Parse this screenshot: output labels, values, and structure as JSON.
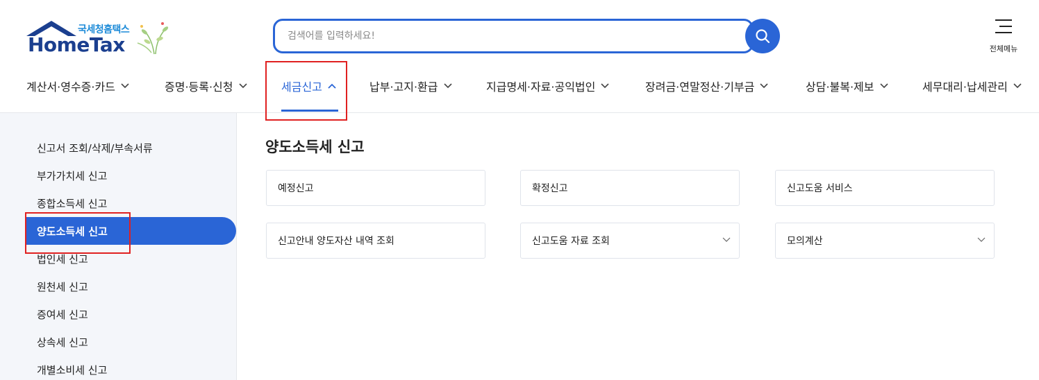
{
  "logo": {
    "sub": "국세청홈택스",
    "main": "HomeTax"
  },
  "search": {
    "placeholder": "검색어를 입력하세요!"
  },
  "menu_all": {
    "label": "전체메뉴"
  },
  "nav": {
    "items": [
      {
        "label": "계산서·영수증·카드"
      },
      {
        "label": "증명·등록·신청"
      },
      {
        "label": "세금신고"
      },
      {
        "label": "납부·고지·환급"
      },
      {
        "label": "지급명세·자료·공익법인"
      },
      {
        "label": "장려금·연말정산·기부금"
      },
      {
        "label": "상담·불복·제보"
      },
      {
        "label": "세무대리·납세관리"
      }
    ]
  },
  "sidebar": {
    "items": [
      {
        "label": "신고서 조회/삭제/부속서류"
      },
      {
        "label": "부가가치세 신고"
      },
      {
        "label": "종합소득세 신고"
      },
      {
        "label": "양도소득세 신고"
      },
      {
        "label": "법인세 신고"
      },
      {
        "label": "원천세 신고"
      },
      {
        "label": "증여세 신고"
      },
      {
        "label": "상속세 신고"
      },
      {
        "label": "개별소비세 신고"
      }
    ]
  },
  "content": {
    "title": "양도소득세 신고",
    "cards": [
      {
        "label": "예정신고"
      },
      {
        "label": "확정신고"
      },
      {
        "label": "신고도움 서비스"
      },
      {
        "label": "신고안내 양도자산 내역 조회"
      },
      {
        "label": "신고도움 자료 조회"
      },
      {
        "label": "모의계산"
      }
    ]
  },
  "colors": {
    "accent": "#2a65d6",
    "highlight": "#e02020",
    "brand": "#1b3f8f"
  }
}
